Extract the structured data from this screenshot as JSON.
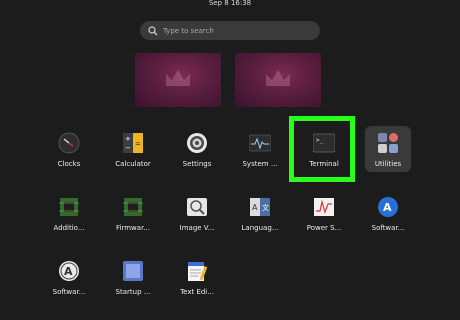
{
  "topbar": {
    "datetime": "Sep 8  16:38"
  },
  "search": {
    "placeholder": "Type to search",
    "icon": "search-icon"
  },
  "workspaces": [
    {
      "name": "workspace-1"
    },
    {
      "name": "workspace-2"
    }
  ],
  "highlight_color": "#2bff1c",
  "apps": [
    {
      "label": "Clocks",
      "icon": "clock-icon"
    },
    {
      "label": "Calculator",
      "icon": "calculator-icon"
    },
    {
      "label": "Settings",
      "icon": "gear-icon"
    },
    {
      "label": "System ...",
      "icon": "system-monitor-icon"
    },
    {
      "label": "Terminal",
      "icon": "terminal-icon",
      "highlighted": true
    },
    {
      "label": "Utilities",
      "icon": "folder-grid-icon",
      "selected": true
    },
    {
      "label": "Additio...",
      "icon": "chip-icon"
    },
    {
      "label": "Firmwar...",
      "icon": "chip-icon"
    },
    {
      "label": "Image V...",
      "icon": "image-viewer-icon"
    },
    {
      "label": "Languag...",
      "icon": "language-icon"
    },
    {
      "label": "Power S...",
      "icon": "power-stats-icon"
    },
    {
      "label": "Softwar...",
      "icon": "software-store-icon"
    },
    {
      "label": "Softwar...",
      "icon": "software-updater-icon"
    },
    {
      "label": "Startup ...",
      "icon": "startup-disk-icon"
    },
    {
      "label": "Text Edi...",
      "icon": "text-editor-icon"
    }
  ]
}
